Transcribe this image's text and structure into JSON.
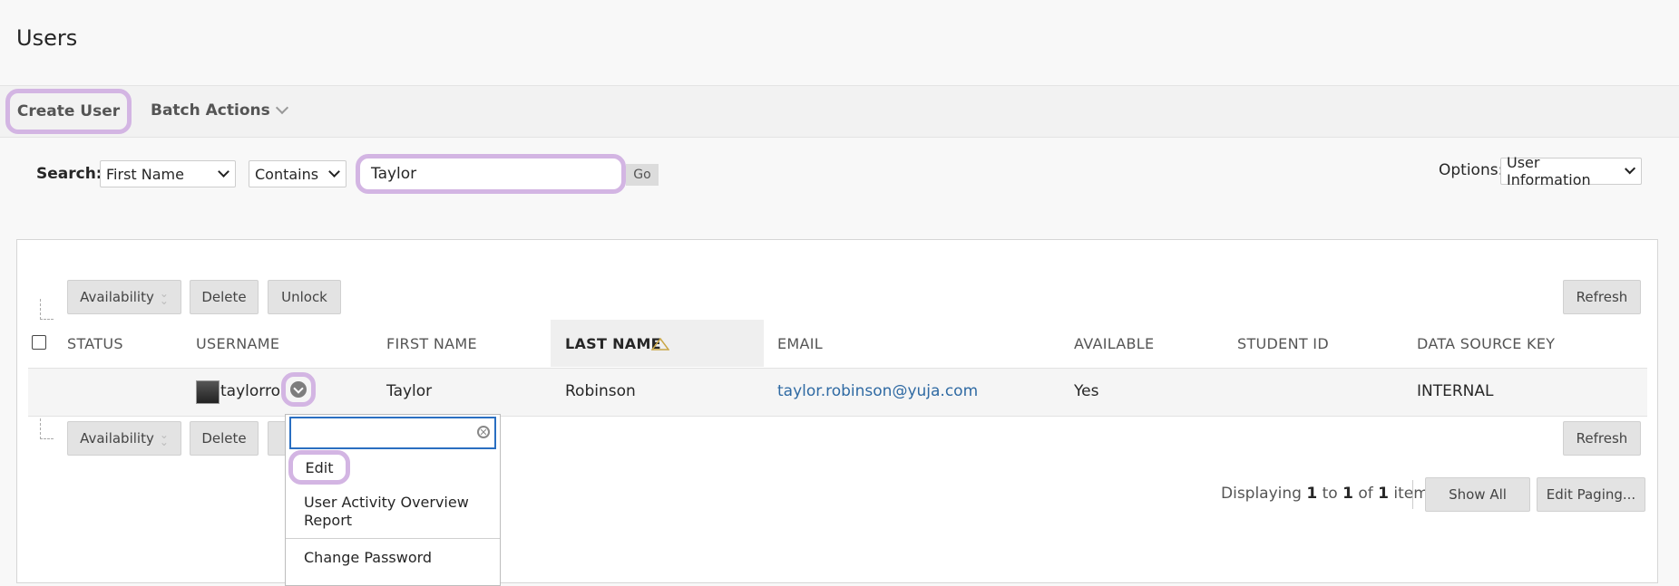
{
  "page_title": "Users",
  "action_bar": {
    "create_user": "Create User",
    "batch_actions": "Batch Actions"
  },
  "search": {
    "label": "Search:",
    "field": "First Name",
    "operator": "Contains",
    "value": "Taylor",
    "go": "Go"
  },
  "options": {
    "label": "Options:",
    "value": "User Information"
  },
  "toolbar": {
    "availability": "Availability",
    "delete": "Delete",
    "unlock": "Unlock",
    "refresh": "Refresh"
  },
  "table": {
    "headers": [
      "STATUS",
      "USERNAME",
      "FIRST NAME",
      "LAST NAME",
      "EMAIL",
      "AVAILABLE",
      "STUDENT ID",
      "DATA SOURCE KEY"
    ],
    "sorted_column": "LAST NAME",
    "rows": [
      {
        "status": "",
        "username": "taylorrob",
        "first_name": "Taylor",
        "last_name": "Robinson",
        "email": "taylor.robinson@yuja.com",
        "available": "Yes",
        "student_id": "",
        "data_source_key": "INTERNAL"
      }
    ]
  },
  "context_menu": {
    "search_placeholder": "",
    "items": [
      "Edit",
      "User Activity Overview Report",
      "Change Password"
    ]
  },
  "paging": {
    "prefix": "Displaying",
    "from": "1",
    "to_word": "to",
    "to": "1",
    "of_word": "of",
    "total": "1",
    "suffix": "items",
    "show_all": "Show All",
    "edit_paging": "Edit Paging..."
  },
  "colors": {
    "highlight": "#d3b5e3",
    "link": "#2f6aa3",
    "focus": "#2a6fc1"
  }
}
